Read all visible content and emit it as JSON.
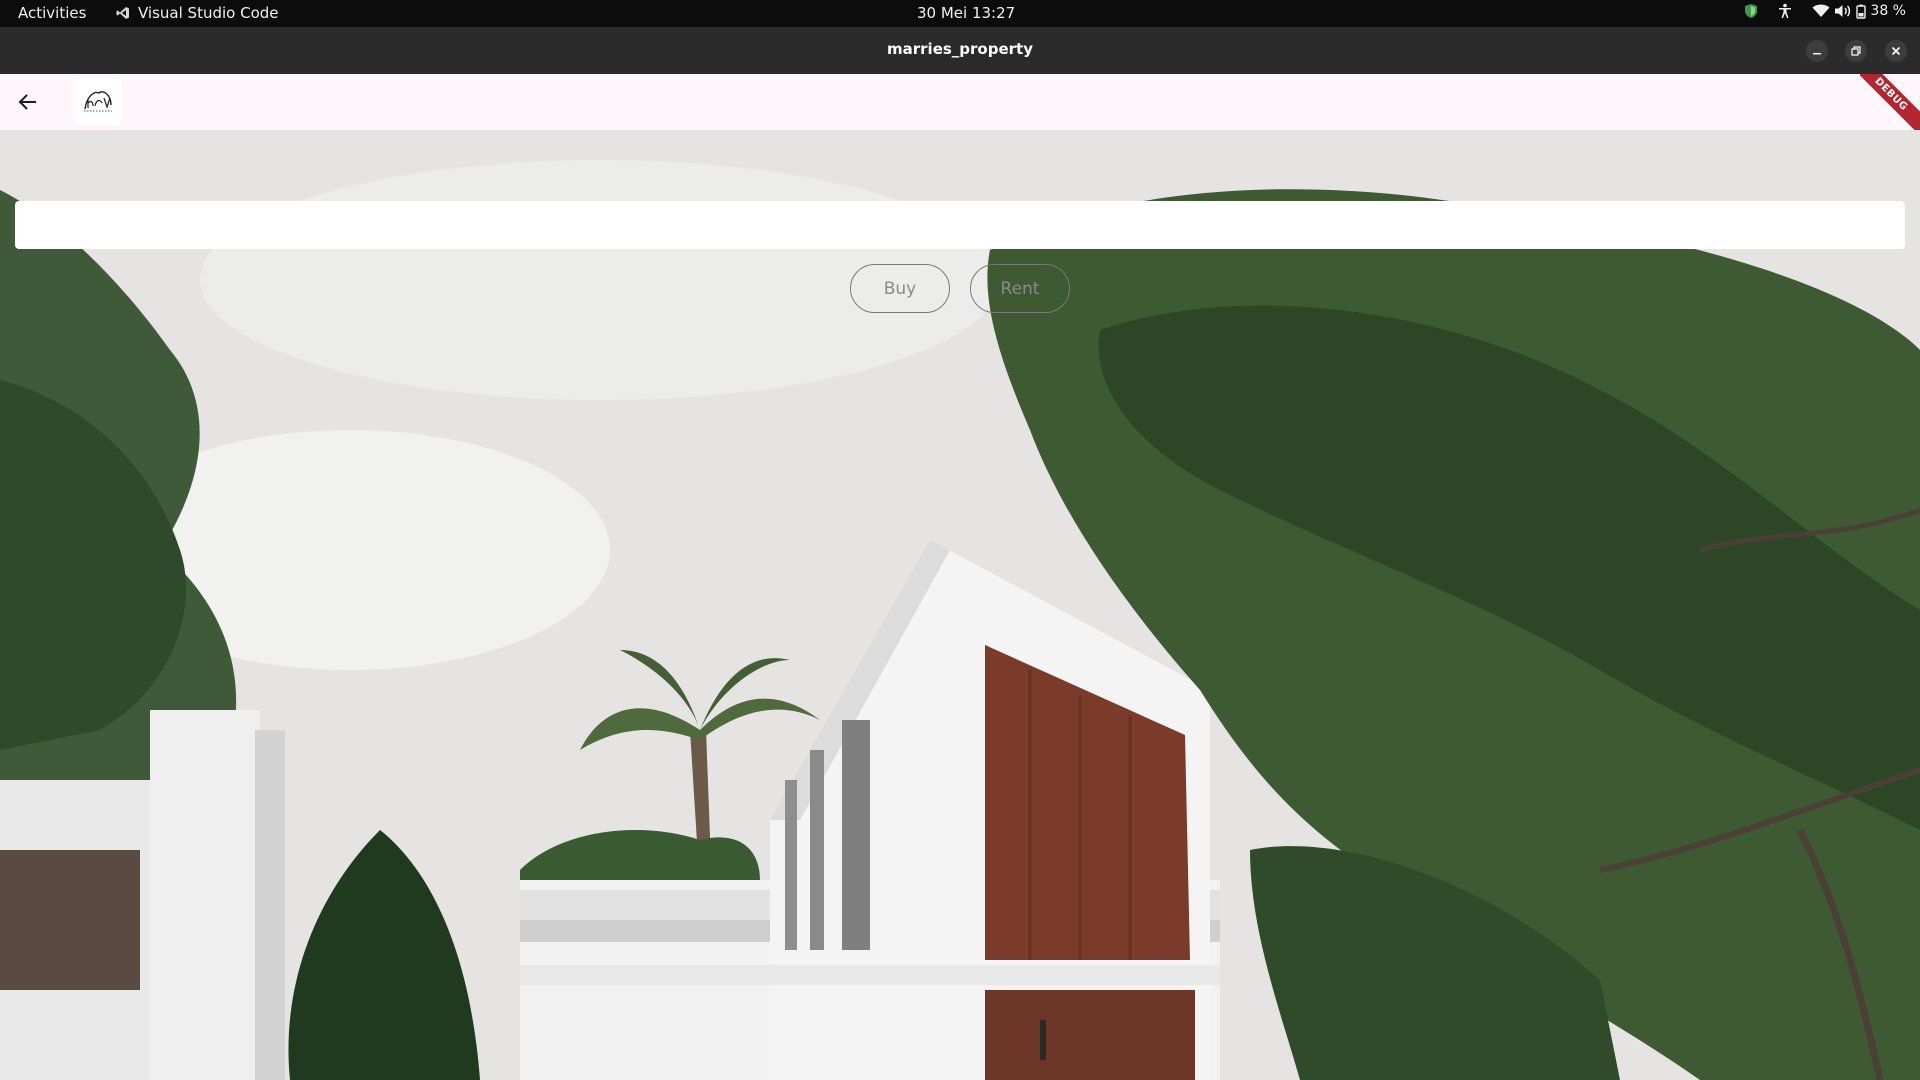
{
  "system_bar": {
    "activities": "Activities",
    "app_name": "Visual Studio Code",
    "app_icon": "vscode-icon",
    "clock": "30 Mei  13:27",
    "battery": "38 %"
  },
  "window": {
    "title": "marries_property"
  },
  "app_bar": {
    "back_icon": "arrow-left-icon",
    "debug_banner": "DEBUG"
  },
  "search": {
    "value": "",
    "placeholder": ""
  },
  "filters": {
    "buy_label": "Buy",
    "rent_label": "Rent"
  },
  "colors": {
    "app_bar_bg": "#fdf6fd",
    "debug_banner": "#b3262f",
    "system_bar_bg": "#0c0c0c",
    "title_bar_bg": "#2b2b2b"
  }
}
